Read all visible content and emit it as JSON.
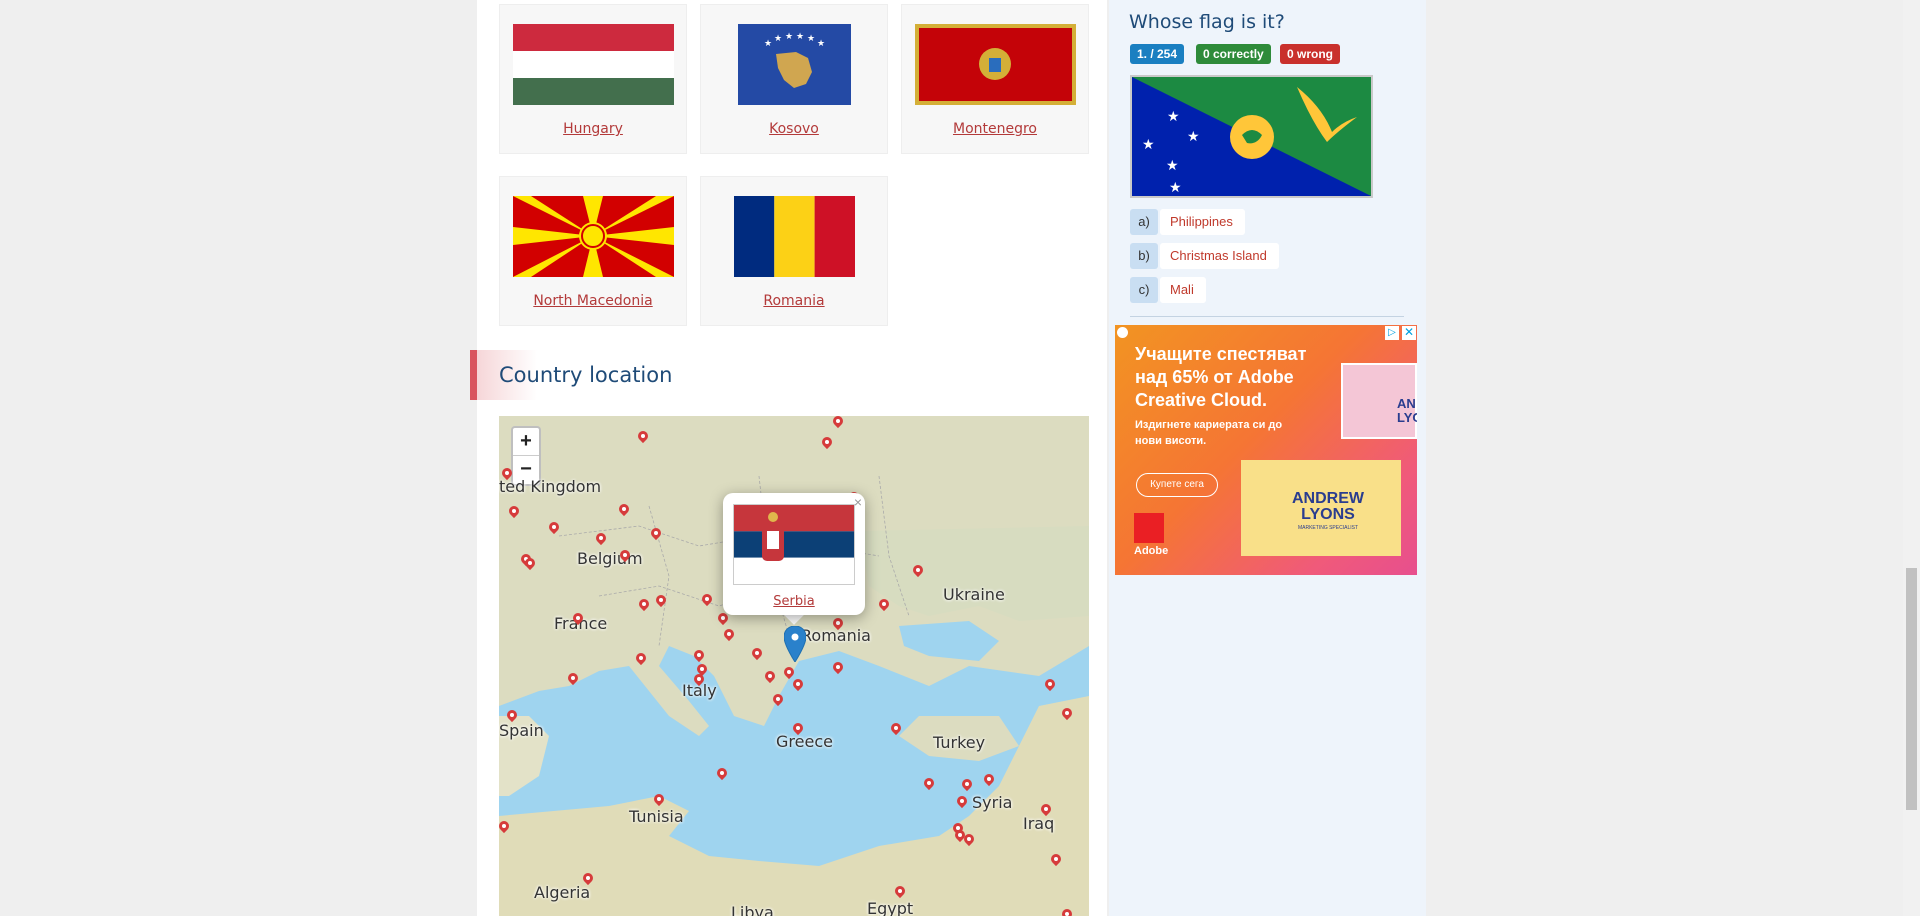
{
  "flags": [
    {
      "name": "Hungary"
    },
    {
      "name": "Kosovo"
    },
    {
      "name": "Montenegro"
    },
    {
      "name": "North Macedonia"
    },
    {
      "name": "Romania"
    }
  ],
  "section": {
    "title": "Country location"
  },
  "map": {
    "zoom_in": "+",
    "zoom_out": "−",
    "labels": [
      "ted Kingdom",
      "Belgium",
      "France",
      "Spain",
      "Italy",
      "Greece",
      "Tunisia",
      "Algeria",
      "Libya",
      "Egypt",
      "Ukraine",
      "Romania",
      "Turkey",
      "Syria",
      "Iraq"
    ],
    "popup": {
      "country": "Serbia",
      "close": "×"
    }
  },
  "quiz": {
    "title": "Whose flag is it?",
    "progress": "1. / 254",
    "correct": "0 correctly",
    "wrong": "0 wrong",
    "answers": [
      {
        "letter": "a)",
        "text": "Philippines"
      },
      {
        "letter": "b)",
        "text": "Christmas Island"
      },
      {
        "letter": "c)",
        "text": "Mali"
      }
    ]
  },
  "ad": {
    "headline": "Учащите спестяват над 65% от Adobe Creative Cloud.",
    "subline": "Издигнете кариерата си до нови висоти.",
    "button": "Купете сега",
    "card_title": "ANDREW LYONS",
    "card_sub": "MARKETING SPECIALIST",
    "portrait_name": "AN LYO",
    "brand": "Adobe",
    "adchoices": "▷",
    "close": "✕"
  },
  "colors": {
    "badge_progress": "#1a7fc1",
    "badge_correct": "#2e8b3a",
    "badge_wrong": "#c9302c"
  }
}
